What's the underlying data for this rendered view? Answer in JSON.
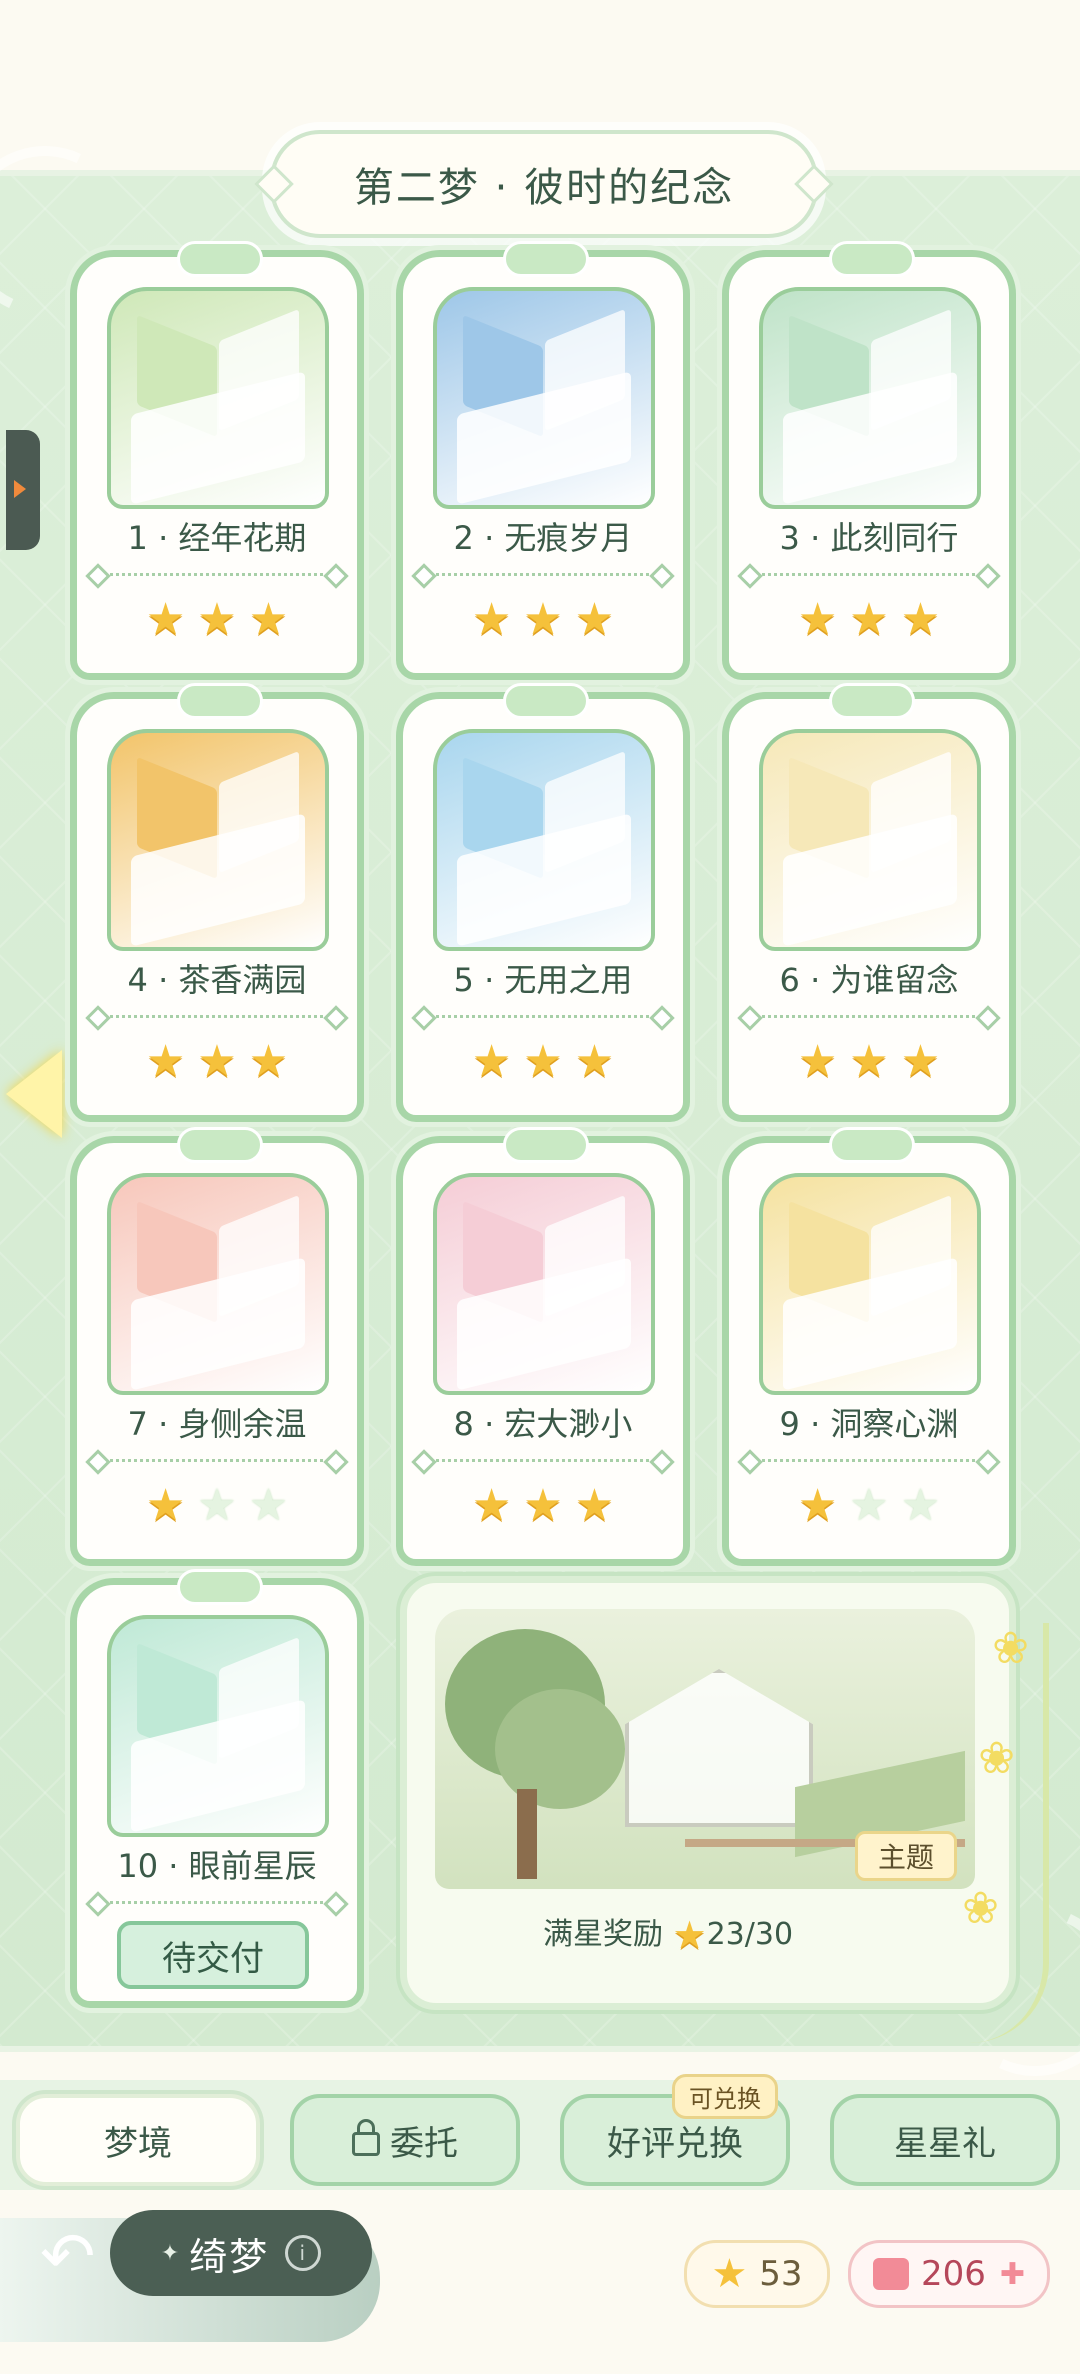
{
  "chapter": {
    "title": "第二梦 · 彼时的纪念"
  },
  "levels": [
    {
      "label": "1 · 经年花期",
      "stars": 3,
      "theme_color": "#cfe8b8"
    },
    {
      "label": "2 · 无痕岁月",
      "stars": 3,
      "theme_color": "#9ec7e8"
    },
    {
      "label": "3 · 此刻同行",
      "stars": 3,
      "theme_color": "#bfe3c8"
    },
    {
      "label": "4 · 茶香满园",
      "stars": 3,
      "theme_color": "#f2c46a"
    },
    {
      "label": "5 · 无用之用",
      "stars": 3,
      "theme_color": "#a9d6ee"
    },
    {
      "label": "6 · 为谁留念",
      "stars": 3,
      "theme_color": "#f6e8b8"
    },
    {
      "label": "7 · 身侧余温",
      "stars": 1,
      "theme_color": "#f7c7bb"
    },
    {
      "label": "8 · 宏大渺小",
      "stars": 3,
      "theme_color": "#f5cdd6"
    },
    {
      "label": "9 · 洞察心渊",
      "stars": 1,
      "theme_color": "#f5e2a0"
    },
    {
      "label": "10 · 眼前星辰",
      "stars": 0,
      "theme_color": "#bfe9d6"
    }
  ],
  "deliver_button": "待交付",
  "reward": {
    "caption": "满星奖励",
    "progress": "23/30",
    "theme_tag": "主题"
  },
  "tabs": [
    {
      "label": "梦境",
      "active": true
    },
    {
      "label": "委托",
      "locked": true
    },
    {
      "label": "好评兑换",
      "badge": "可兑换"
    },
    {
      "label": "星星礼"
    }
  ],
  "footer": {
    "dream_label": "绮梦",
    "star_count": "53",
    "like_count": "206"
  }
}
